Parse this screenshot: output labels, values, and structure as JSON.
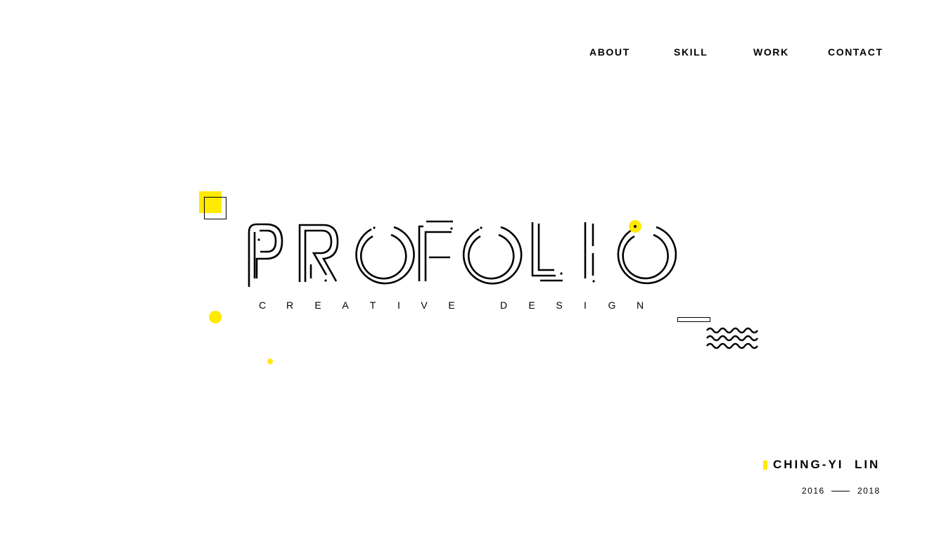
{
  "nav": {
    "items": [
      {
        "label": "ABOUT"
      },
      {
        "label": "SKILL"
      },
      {
        "label": "WORK"
      },
      {
        "label": "CONTACT"
      }
    ]
  },
  "hero": {
    "logo_text": "PROFOLIO",
    "subtitle_letters": [
      "C",
      "R",
      "E",
      "A",
      "T",
      "I",
      "V",
      "E",
      "D",
      "E",
      "S",
      "I",
      "G",
      "N"
    ],
    "subtitle_full": "CREATIVE DESIGN"
  },
  "author": {
    "name": "CHING-YI  LIN",
    "year_start": "2016",
    "year_end": "2018"
  },
  "colors": {
    "accent": "#ffea00",
    "text": "#000000",
    "background": "#ffffff"
  }
}
